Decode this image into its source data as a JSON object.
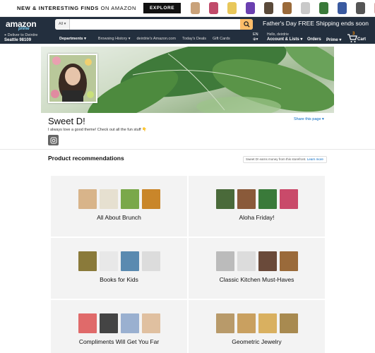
{
  "promo": {
    "headline_bold": "NEW & INTERESTING FINDS",
    "headline_rest": " ON AMAZON",
    "explore_label": "EXPLORE",
    "item_colors": [
      "#c9a27a",
      "#c04a6a",
      "#e8c75a",
      "#6a3fb0",
      "#5a4a3a",
      "#9a6a3a",
      "#c9c9c9",
      "#3a7a3a",
      "#3a5aa0",
      "#555555",
      "#d9a0a0"
    ]
  },
  "nav": {
    "logo": "amazon",
    "logo_sub": "prime",
    "search_dept": "All ▾",
    "search_placeholder": "",
    "fathers_day": "Father's Day FREE Shipping ends soon",
    "deliver_line1": "Deliver to Deirdre",
    "deliver_line2": "Seattle 98109",
    "departments": "Departments ▾",
    "links": [
      "Browsing History ▾",
      "deirdrie's Amazon.com",
      "Today's Deals",
      "Gift Cards"
    ],
    "lang": "EN",
    "hello": "Hello, deirdrie",
    "account": "Account & Lists ▾",
    "orders": "Orders",
    "prime": "Prime ▾",
    "cart_count": "3",
    "cart": "Cart"
  },
  "profile": {
    "name": "Sweet D!",
    "bio": "I always love a good theme! Check out all the fun stuff 👇",
    "share": "Share this page ▾"
  },
  "recommendations": {
    "title": "Product recommendations",
    "disclosure": "Sweet D! earns money from this storefront.",
    "learn_more": "Learn more",
    "cards": [
      {
        "title": "All About Brunch",
        "colors": [
          "#d8b48a",
          "#e6e0d0",
          "#7aa84a",
          "#c9862a"
        ]
      },
      {
        "title": "Aloha Friday!",
        "colors": [
          "#4a6a3a",
          "#8a5a3a",
          "#3a7a3a",
          "#c94a6a"
        ]
      },
      {
        "title": "Books for Kids",
        "colors": [
          "#8a7a3a",
          "#e8e8e8",
          "#5a8ab0",
          "#dcdcdc"
        ]
      },
      {
        "title": "Classic Kitchen Must-Haves",
        "colors": [
          "#bbbbbb",
          "#dcdcdc",
          "#6a4a3a",
          "#9a6a3a"
        ]
      },
      {
        "title": "Compliments Will Get You Far",
        "colors": [
          "#e06a6a",
          "#444444",
          "#9ab0d0",
          "#e0c0a0"
        ]
      },
      {
        "title": "Geometric Jewelry",
        "colors": [
          "#b89a6a",
          "#c9a060",
          "#d9b060",
          "#a88a50"
        ]
      }
    ]
  }
}
